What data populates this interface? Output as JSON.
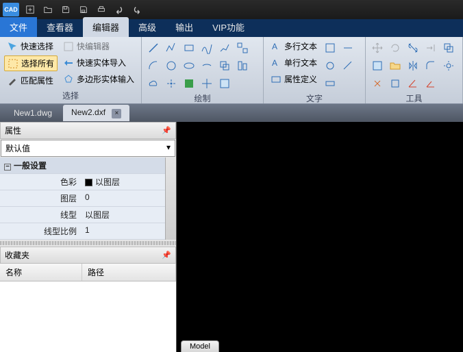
{
  "title": {
    "logo": "CAD"
  },
  "menu": {
    "file": "文件",
    "view": "查看器",
    "edit": "编辑器",
    "adv": "高级",
    "out": "输出",
    "vip": "VIP功能"
  },
  "sel": {
    "quick": "快速选择",
    "all": "选择所有",
    "match": "匹配属性",
    "qedit": "快编辑器",
    "entity": "快速实体导入",
    "poly": "多边形实体输入",
    "group": "选择"
  },
  "draw": {
    "group": "绘制"
  },
  "text": {
    "mtext": "多行文本",
    "stext": "单行文本",
    "attdef": "属性定义",
    "group": "文字"
  },
  "tools": {
    "group": "工具"
  },
  "tabs": {
    "t1": "New1.dwg",
    "t2": "New2.dxf",
    "close": "×"
  },
  "props": {
    "title": "属性",
    "default": "默认值",
    "dropdown": "▾",
    "pin": "📌",
    "general": "一般设置",
    "color": "色彩",
    "colorv": "以图层",
    "layer": "图层",
    "layerv": "0",
    "ltype": "线型",
    "ltypev": "以图层",
    "lscale": "线型比例",
    "lscalev": "1",
    "toggle": "−"
  },
  "fav": {
    "title": "收藏夹",
    "name": "名称",
    "path": "路径"
  },
  "model": {
    "tab": "Model"
  }
}
